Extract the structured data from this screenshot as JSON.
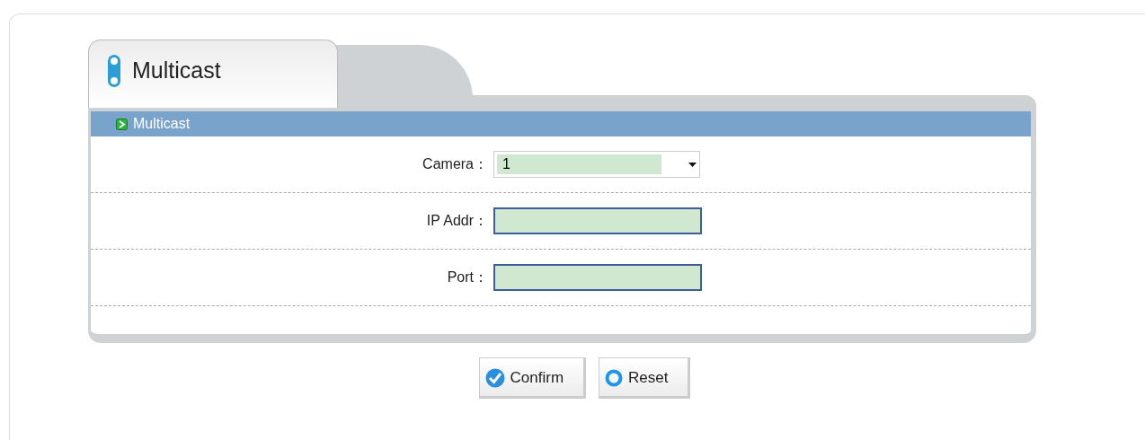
{
  "tab": {
    "label": "Multicast",
    "selected": true
  },
  "section": {
    "title": "Multicast"
  },
  "fields": [
    {
      "kind": "select",
      "label": "Camera：",
      "value": "1"
    },
    {
      "kind": "text",
      "label": "IP Addr："
    },
    {
      "kind": "text",
      "label": "Port："
    }
  ],
  "buttons": [
    {
      "kind": "confirm",
      "label": "Confirm"
    },
    {
      "kind": "reset",
      "label": "Reset"
    }
  ]
}
